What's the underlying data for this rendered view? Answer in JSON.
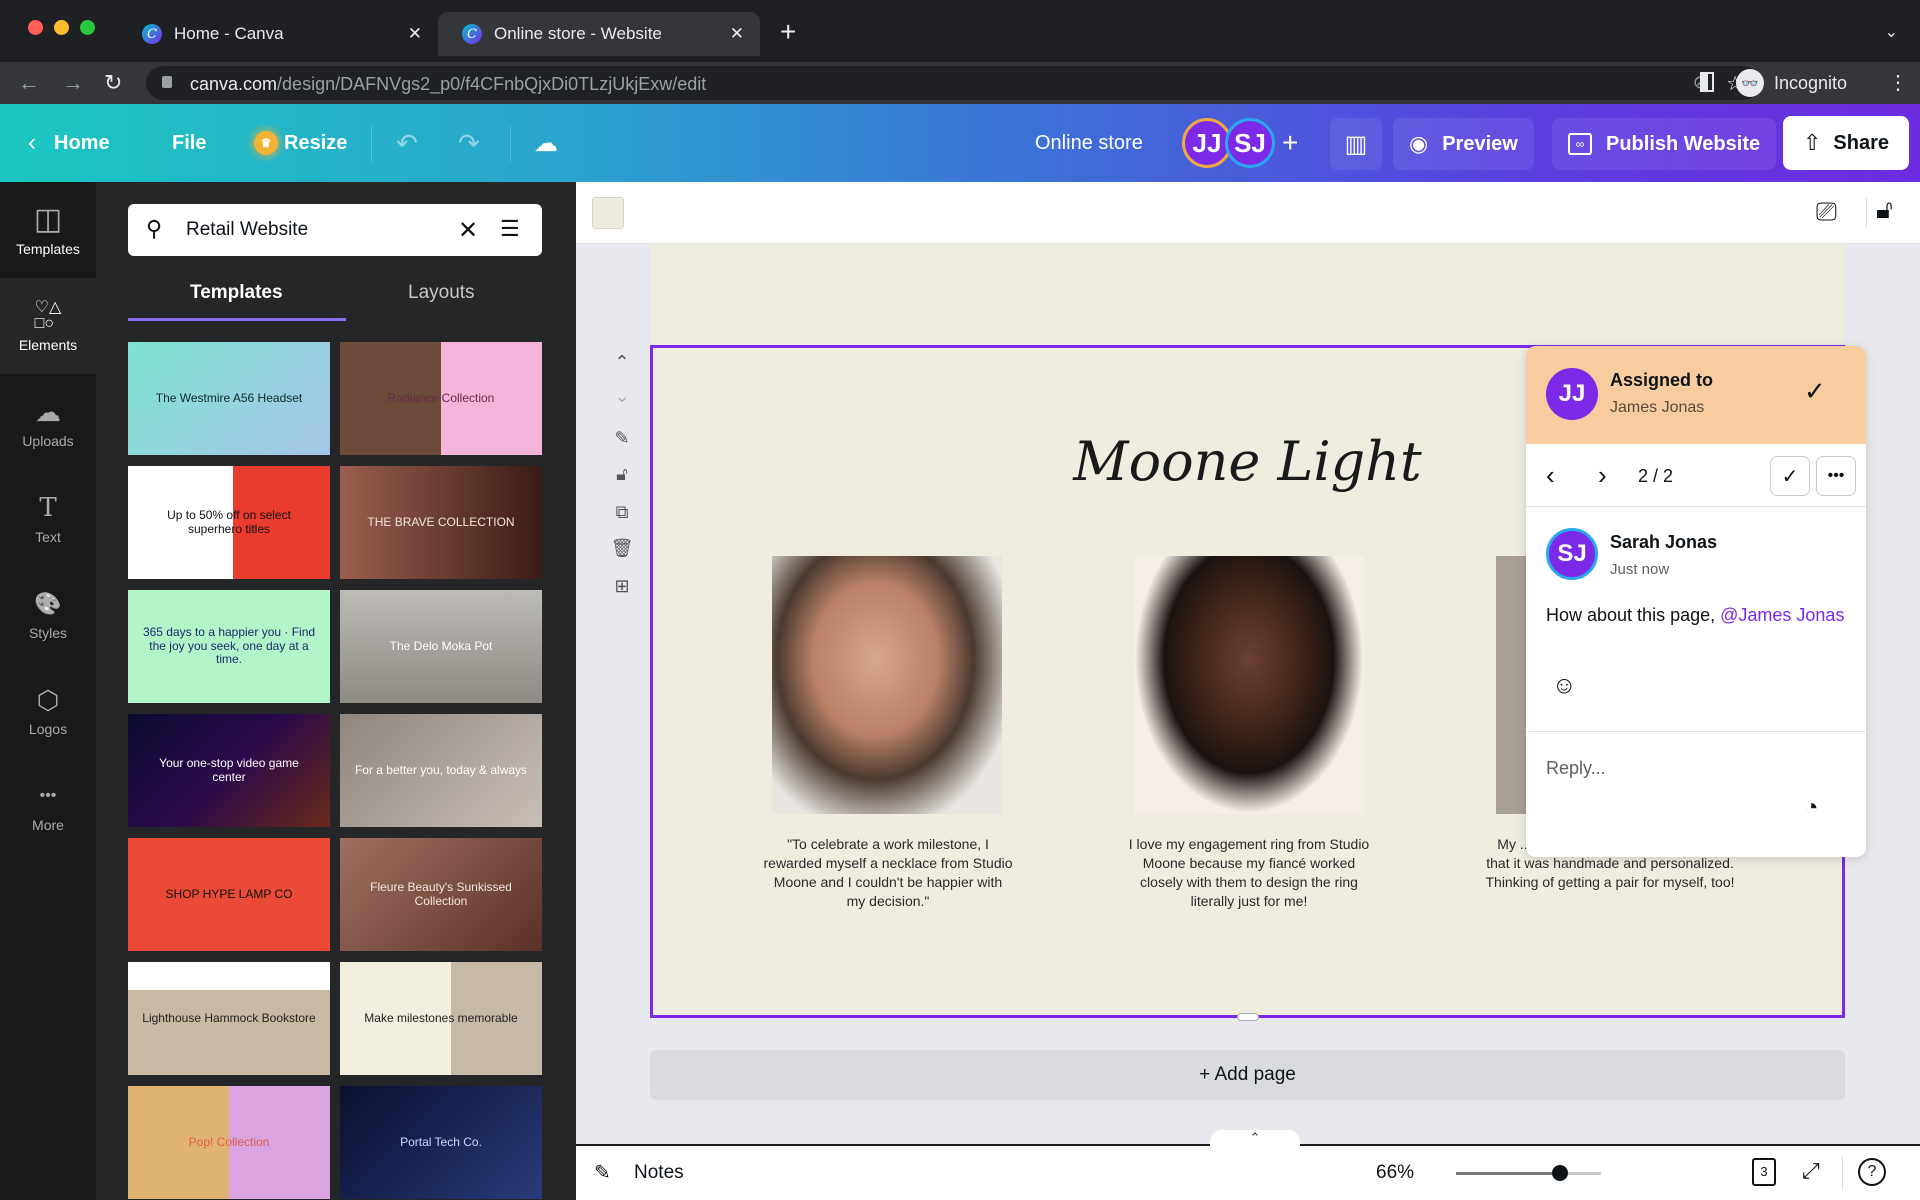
{
  "browser": {
    "tabs": [
      {
        "title": "Home - Canva",
        "active": false
      },
      {
        "title": "Online store - Website",
        "active": true
      }
    ],
    "url_host": "canva.com",
    "url_path": "/design/DAFNVgs2_p0/f4CFnbQjxDi0TLzjUkjExw/edit",
    "profile_label": "Incognito"
  },
  "header": {
    "home_label": "Home",
    "file_label": "File",
    "resize_label": "Resize",
    "design_title": "Online store",
    "collaborators": [
      {
        "initials": "JJ",
        "ring": "#f0a843"
      },
      {
        "initials": "SJ",
        "ring": "#29a8f0"
      }
    ],
    "preview_label": "Preview",
    "publish_label": "Publish Website",
    "share_label": "Share"
  },
  "rail": {
    "items": [
      {
        "label": "Templates",
        "icon": "templates-icon",
        "glyph": "◫",
        "active": true
      },
      {
        "label": "Elements",
        "icon": "elements-icon",
        "glyph": "♡△",
        "active": false
      },
      {
        "label": "Uploads",
        "icon": "upload-cloud-icon",
        "glyph": "☁",
        "active": false
      },
      {
        "label": "Text",
        "icon": "text-icon",
        "glyph": "T",
        "active": false
      },
      {
        "label": "Styles",
        "icon": "palette-icon",
        "glyph": "🎨",
        "active": false
      },
      {
        "label": "Logos",
        "icon": "logos-icon",
        "glyph": "⬡",
        "active": false
      },
      {
        "label": "More",
        "icon": "more-icon",
        "glyph": "•••",
        "active": false
      }
    ]
  },
  "panel": {
    "search_value": "Retail Website",
    "tabs": [
      {
        "label": "Templates",
        "active": true
      },
      {
        "label": "Layouts",
        "active": false
      }
    ],
    "templates": [
      {
        "text": "The Westmire A56 Headset",
        "bg": "linear-gradient(135deg,#7fe3d0,#a5c6e8)",
        "color": "#0e2a2a"
      },
      {
        "text": "Radiance Collection",
        "bg": "linear-gradient(90deg,#6b4b3a 50%,#f5b4d9 50%)",
        "color": "#6b2a47"
      },
      {
        "text": "Up to 50% off on select superhero titles",
        "bg": "linear-gradient(90deg,#ffffff 52%,#e93b2e 52%)",
        "color": "#111"
      },
      {
        "text": "THE BRAVE COLLECTION",
        "bg": "linear-gradient(90deg,#9a5e4e,#3a1c16)",
        "color": "#f3e6dc"
      },
      {
        "text": "365 days to a happier you · Find the joy you seek, one day at a time.",
        "bg": "#b2f5c9",
        "color": "#1a2a6b"
      },
      {
        "text": "The Delo Moka Pot",
        "bg": "linear-gradient(180deg,#bdbbb6,#8e8a84)",
        "color": "#fff"
      },
      {
        "text": "Your one-stop video game center",
        "bg": "linear-gradient(135deg,#0a0a2e,#2a0a4a,#6a2a1a)",
        "color": "#fff"
      },
      {
        "text": "For a better you, today & always",
        "bg": "linear-gradient(135deg,#8f8680,#c9bfb7)",
        "color": "#fff"
      },
      {
        "text": "SHOP HYPE LAMP CO",
        "bg": "#ea4a36",
        "color": "#111"
      },
      {
        "text": "Fleure Beauty's Sunkissed Collection",
        "bg": "linear-gradient(135deg,#a07060,#5a3028)",
        "color": "#f5e6e0"
      },
      {
        "text": "Lighthouse Hammock Bookstore",
        "bg": "linear-gradient(180deg,#fff 25%,#c8b9a2 25%)",
        "color": "#222"
      },
      {
        "text": "Make milestones memorable",
        "bg": "linear-gradient(90deg,#f2efe0 55%,#c7b9a8 55%)",
        "color": "#222"
      },
      {
        "text": "Pop! Collection",
        "bg": "linear-gradient(90deg,#e0b370 50%,#d9a4e0 50%)",
        "color": "#e05a4a"
      },
      {
        "text": "Portal Tech Co.",
        "bg": "linear-gradient(135deg,#0b1030,#2a3a7a)",
        "color": "#cfd8ff"
      }
    ]
  },
  "canvas": {
    "title": "Moone Light",
    "testimonials": [
      "\"To celebrate a work milestone, I rewarded myself a necklace from Studio Moone and I couldn't be happier with my decision.\"",
      "I love my engagement ring from Studio Moone because my fiancé worked closely with them to design the ring literally just for me!",
      "My ... her for her birthday. She loved that it was handmade and personalized. Thinking of getting a pair for myself, too!"
    ],
    "add_page_label": "+ Add page"
  },
  "comment": {
    "assigned_label": "Assigned to",
    "assignee": "James Jonas",
    "assignee_initials": "JJ",
    "pager": "2 / 2",
    "author": "Sarah Jonas",
    "author_initials": "SJ",
    "time": "Just now",
    "body": "How about this page, ",
    "mention": "@James Jonas",
    "reply_placeholder": "Reply..."
  },
  "bottom": {
    "notes_label": "Notes",
    "zoom_label": "66%",
    "zoom_fraction": 0.72,
    "page_count": "3"
  },
  "colors": {
    "accent": "#7d2ae8",
    "mention": "#7d2ae8",
    "assigned_bg": "#f8cc9e"
  }
}
